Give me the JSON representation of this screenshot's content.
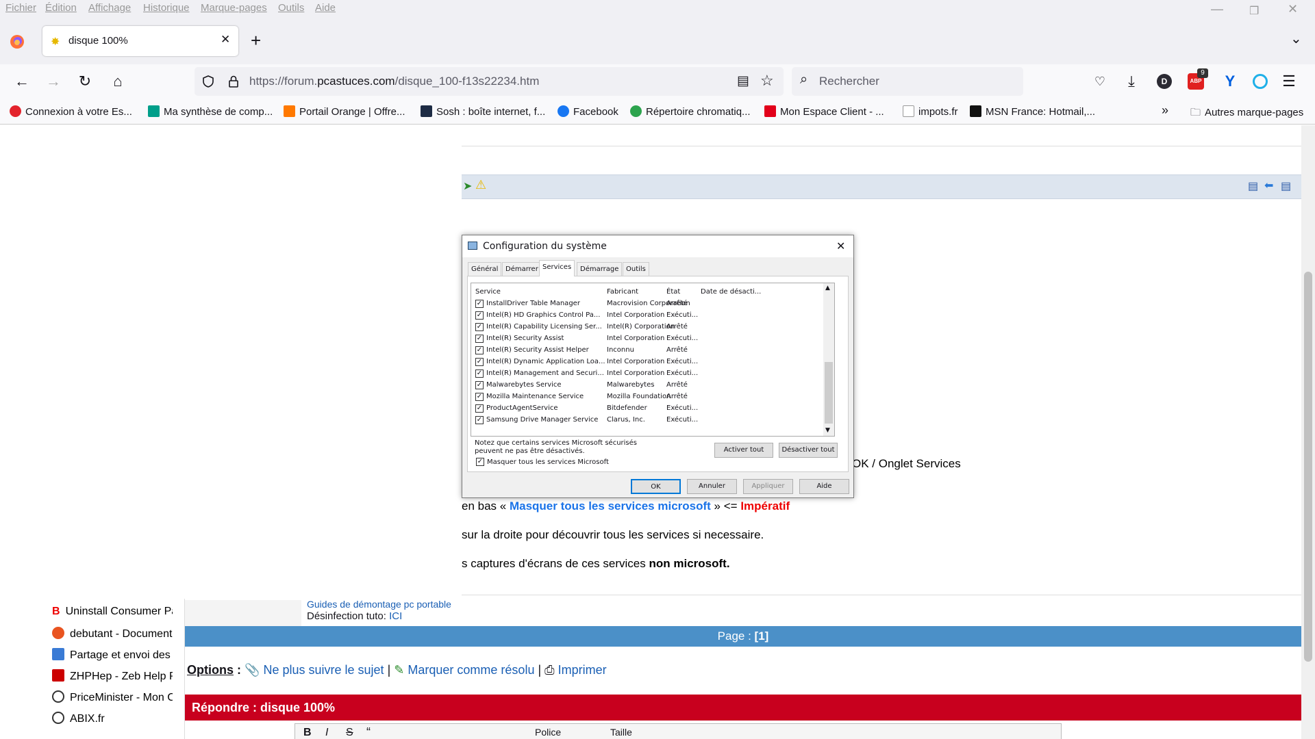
{
  "menubar": {
    "items": [
      "Fichier",
      "Édition",
      "Affichage",
      "Historique",
      "Marque-pages",
      "Outils",
      "Aide"
    ]
  },
  "tab": {
    "title": "disque 100%"
  },
  "urlbar": {
    "url_prefix": "https://forum.",
    "url_domain": "pcastuces.com",
    "url_path": "/disque_100-f13s22234.htm"
  },
  "search": {
    "placeholder": "Rechercher"
  },
  "extensions": {
    "abp_count": "9",
    "profile_initial": "D"
  },
  "bookmarks": {
    "items": [
      "Connexion à votre Es...",
      "Ma synthèse de comp...",
      "Portail Orange | Offre...",
      "Sosh : boîte internet, f...",
      "Facebook",
      "Répertoire chromatiq...",
      "Mon Espace Client - ...",
      "impots.fr",
      "MSN France: Hotmail,..."
    ],
    "other": "Autres marque-pages"
  },
  "dialog": {
    "title": "Configuration du système",
    "tabs": [
      "Général",
      "Démarrer",
      "Services",
      "Démarrage",
      "Outils"
    ],
    "columns": [
      "Service",
      "Fabricant",
      "État",
      "Date de désacti..."
    ],
    "rows": [
      {
        "service": "InstallDriver Table Manager",
        "maker": "Macrovision Corporation",
        "state": "Arrêté"
      },
      {
        "service": "Intel(R) HD Graphics Control Pa...",
        "maker": "Intel Corporation",
        "state": "Exécuti..."
      },
      {
        "service": "Intel(R) Capability Licensing Ser...",
        "maker": "Intel(R) Corporation",
        "state": "Arrêté"
      },
      {
        "service": "Intel(R) Security Assist",
        "maker": "Intel Corporation",
        "state": "Exécuti..."
      },
      {
        "service": "Intel(R) Security Assist Helper",
        "maker": "Inconnu",
        "state": "Arrêté"
      },
      {
        "service": "Intel(R) Dynamic Application Loa...",
        "maker": "Intel Corporation",
        "state": "Exécuti..."
      },
      {
        "service": "Intel(R) Management and Securi...",
        "maker": "Intel Corporation",
        "state": "Exécuti..."
      },
      {
        "service": "Malwarebytes Service",
        "maker": "Malwarebytes",
        "state": "Arrêté"
      },
      {
        "service": "Mozilla Maintenance Service",
        "maker": "Mozilla Foundation",
        "state": "Arrêté"
      },
      {
        "service": "ProductAgentService",
        "maker": "Bitdefender",
        "state": "Exécuti..."
      },
      {
        "service": "Samsung Drive Manager Service",
        "maker": "Clarus, Inc.",
        "state": "Exécuti..."
      }
    ],
    "note": "Notez que certains services Microsoft sécurisés peuvent ne pas être désactivés.",
    "hide_ms_label": "Masquer tous les services Microsoft",
    "enable_all": "Activer tout",
    "disable_all": "Désactiver tout",
    "ok": "OK",
    "cancel": "Annuler",
    "apply": "Appliquer",
    "help": "Aide"
  },
  "post": {
    "line1_tail": "OK / Onglet Services",
    "line2_a": "en bas «",
    "line2_b": "Masquer tous les services microsoft",
    "line2_c": "» <=",
    "line2_d": "Impératif",
    "line3": "sur la droite pour découvrir tous les services si necessaire.",
    "line4_a": "s captures d'écrans de ces services",
    "line4_b": "non microsoft."
  },
  "signature": {
    "link1": "Guides de démontage pc portable",
    "label2": "Désinfection tuto:",
    "link2": "ICI"
  },
  "sidebar": {
    "items": [
      "Uninstall Consumer Pai",
      "debutant - Documenta",
      "Partage et envoi des g.",
      "ZHPHep - Zeb Help Pr",
      "PriceMinister - Mon Co",
      "ABIX.fr"
    ]
  },
  "pager": {
    "label": "Page :",
    "current": "[1]"
  },
  "options": {
    "label": "Options",
    "colon": ":",
    "unfollow": "Ne plus suivre le sujet",
    "resolved": "Marquer comme résolu",
    "print": "Imprimer",
    "sep": "|"
  },
  "reply": {
    "title": "Répondre : disque 100%"
  },
  "editor": {
    "font": "Police",
    "size": "Taille"
  }
}
